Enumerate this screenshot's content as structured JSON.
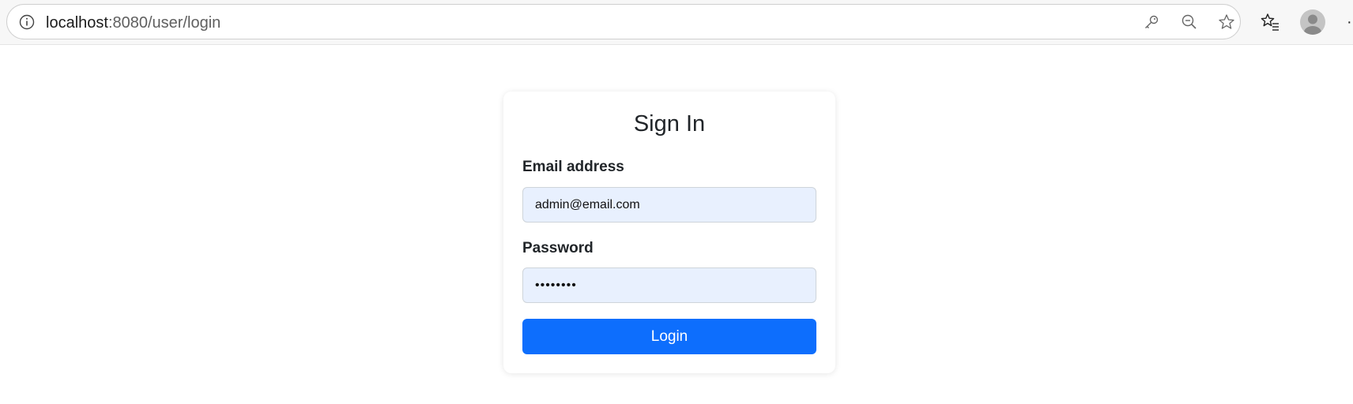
{
  "browser": {
    "url_host": "localhost",
    "url_rest": ":8080/user/login",
    "icons": [
      "info-icon",
      "key-icon",
      "zoom-out-icon",
      "star-icon",
      "favorites-icon",
      "avatar-icon",
      "more-icon"
    ]
  },
  "login_form": {
    "title": "Sign In",
    "email_label": "Email address",
    "email_value": "admin@email.com",
    "password_label": "Password",
    "password_value": "adminpwd",
    "submit_label": "Login"
  },
  "colors": {
    "primary": "#0d6efd",
    "input_background": "#e8f0fe",
    "text": "#212529"
  }
}
